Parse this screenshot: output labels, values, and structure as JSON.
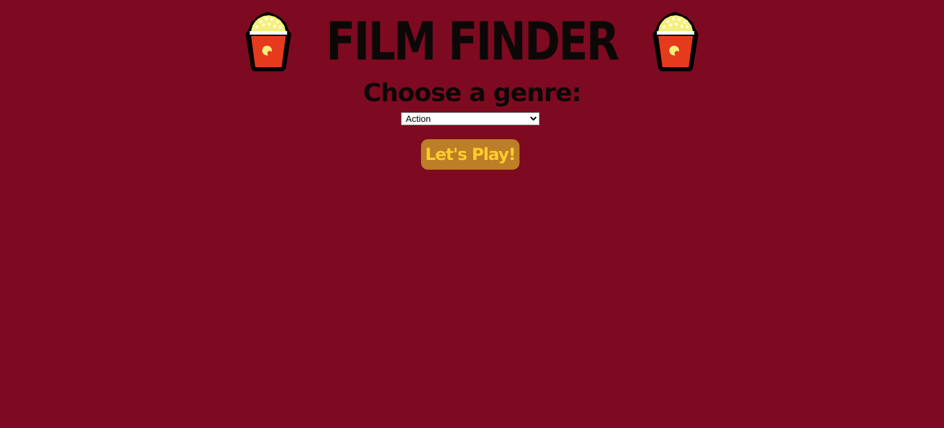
{
  "header": {
    "title": "FILM FINDER",
    "left_icon": "popcorn-icon",
    "right_icon": "popcorn-icon"
  },
  "genre": {
    "heading": "Choose a genre:",
    "selected": "Action"
  },
  "play_button": {
    "label": "Let's Play!"
  },
  "colors": {
    "background": "#7d0a20",
    "title_text": "#0d0808",
    "button_bg": "#bc7e26",
    "button_text": "#ffcc2e",
    "popcorn_bucket": "#e63a1c",
    "popcorn_kernels": "#f4ef7c"
  }
}
